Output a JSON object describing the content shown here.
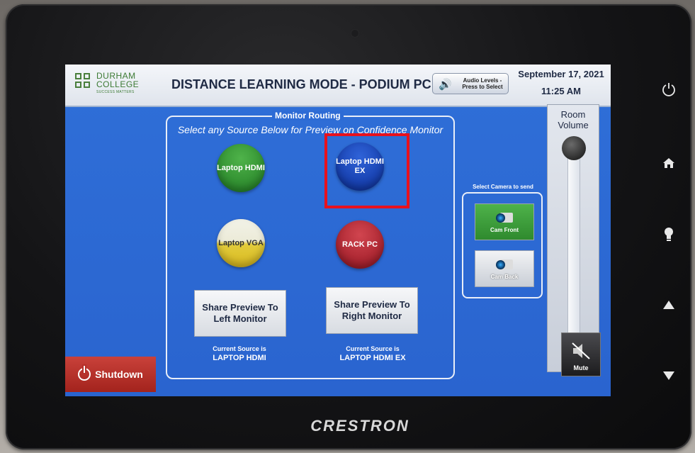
{
  "header": {
    "logo_line1": "DURHAM",
    "logo_line2": "COLLEGE",
    "logo_tagline": "SUCCESS MATTERS",
    "title": "DISTANCE LEARNING MODE - PODIUM PC",
    "audio_label": "Audio Levels - Press to Select",
    "date": "September 17, 2021",
    "time": "11:25 AM"
  },
  "routing": {
    "title": "Monitor Routing",
    "hint": "Select any Source Below for Preview on Confidence Monitor",
    "sources": [
      {
        "label": "Laptop HDMI",
        "color": "#2f9a2f"
      },
      {
        "label": "Laptop HDMI EX",
        "color": "#173fbf",
        "highlighted": true
      },
      {
        "label": "Laptop VGA",
        "color": "#e2cc3c"
      },
      {
        "label": "RACK PC",
        "color": "#b82432"
      }
    ],
    "share_left": "Share Preview To Left Monitor",
    "share_right": "Share Preview To Right Monitor",
    "current_left_label": "Current Source is",
    "current_left_value": "LAPTOP HDMI",
    "current_right_label": "Current Source is",
    "current_right_value": "LAPTOP HDMI EX"
  },
  "camera": {
    "title": "Select Camera to send",
    "front": "Cam Front",
    "back": "Cam Back"
  },
  "volume": {
    "label": "Room Volume",
    "mute": "Mute"
  },
  "shutdown": "Shutdown",
  "device": {
    "brand": "CRESTRON",
    "side_buttons": [
      "power-icon",
      "home-icon",
      "lightbulb-icon",
      "up-arrow-icon",
      "down-arrow-icon"
    ]
  },
  "colors": {
    "screen_bg": "#2c68d2",
    "highlight": "#e8111d",
    "shutdown": "#b5302a"
  }
}
